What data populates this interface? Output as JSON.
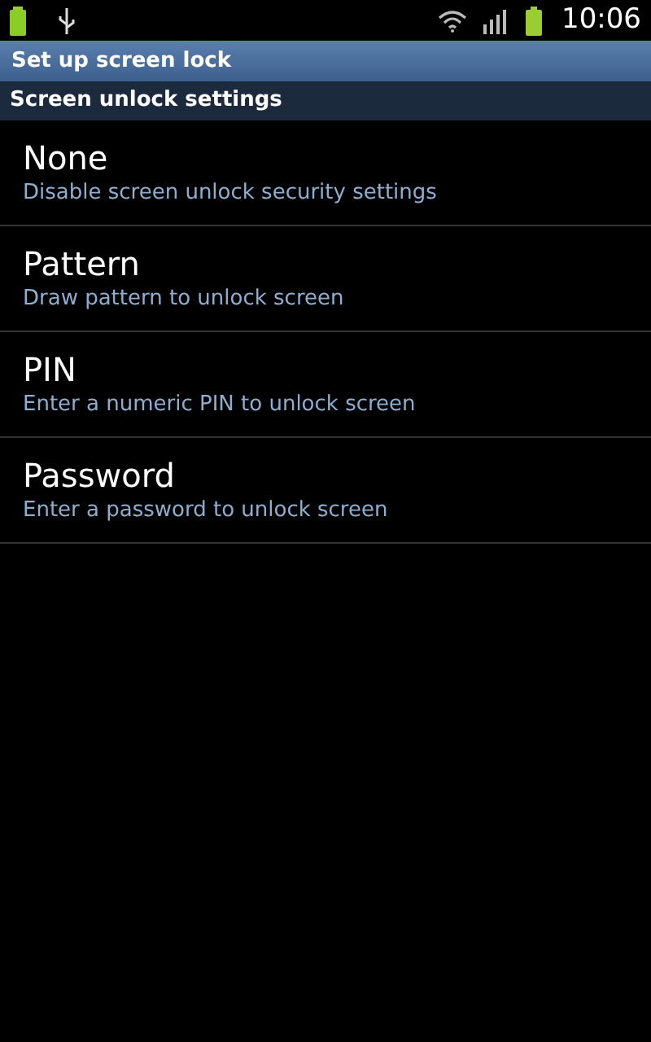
{
  "status_bar": {
    "time": "10:06"
  },
  "title_bar": {
    "title": "Set up screen lock"
  },
  "section": {
    "title": "Screen unlock settings"
  },
  "options": [
    {
      "title": "None",
      "summary": "Disable screen unlock security settings"
    },
    {
      "title": "Pattern",
      "summary": "Draw pattern to unlock screen"
    },
    {
      "title": "PIN",
      "summary": "Enter a numeric PIN to unlock screen"
    },
    {
      "title": "Password",
      "summary": "Enter a password to unlock screen"
    }
  ]
}
